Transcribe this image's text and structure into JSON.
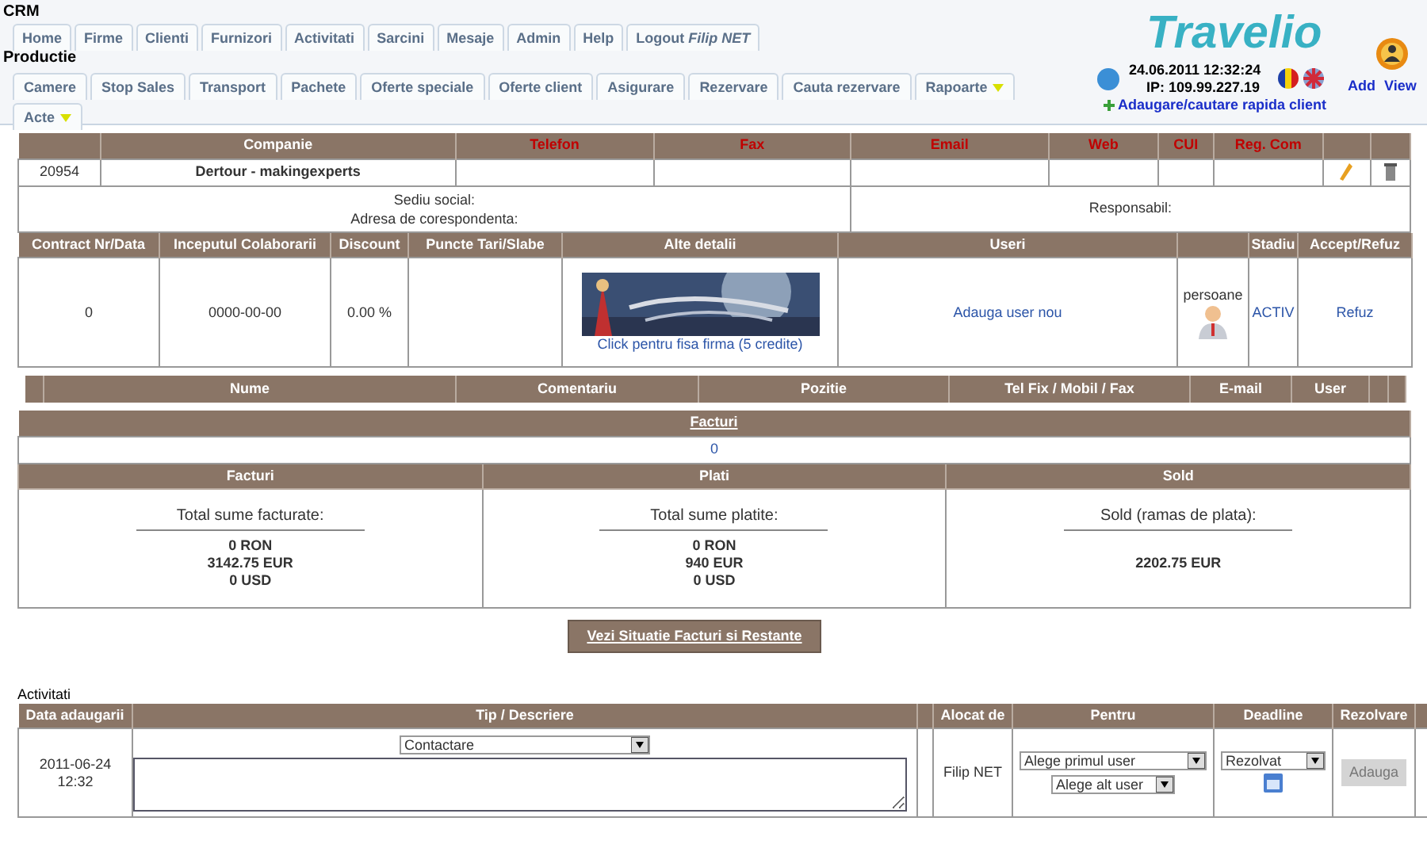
{
  "app_title": "CRM",
  "main_tabs": [
    {
      "label": "Home"
    },
    {
      "label": "Firme"
    },
    {
      "label": "Clienti"
    },
    {
      "label": "Furnizori"
    },
    {
      "label": "Activitati"
    },
    {
      "label": "Sarcini"
    },
    {
      "label": "Mesaje"
    },
    {
      "label": "Admin"
    },
    {
      "label": "Help"
    },
    {
      "label": "Logout *Filip NET*"
    }
  ],
  "section_title": "Productie",
  "sub_tabs": [
    {
      "label": "Camere",
      "dropdown": false
    },
    {
      "label": "Stop Sales",
      "dropdown": false
    },
    {
      "label": "Transport",
      "dropdown": false
    },
    {
      "label": "Pachete",
      "dropdown": false
    },
    {
      "label": "Oferte speciale",
      "dropdown": false
    },
    {
      "label": "Oferte client",
      "dropdown": false
    },
    {
      "label": "Asigurare",
      "dropdown": false
    },
    {
      "label": "Rezervare",
      "dropdown": false
    },
    {
      "label": "Cauta rezervare",
      "dropdown": false
    },
    {
      "label": "Rapoarte",
      "dropdown": true
    },
    {
      "label": "Acte",
      "dropdown": true
    }
  ],
  "header": {
    "logo": "Travelio",
    "datetime": "24.06.2011 12:32:24",
    "ip": "IP: 109.99.227.19",
    "quick_add": "Adaugare/cautare rapida client",
    "add": "Add",
    "view": "View"
  },
  "company_table": {
    "columns": [
      {
        "label": "Companie",
        "accent": false
      },
      {
        "label": "Telefon",
        "accent": true
      },
      {
        "label": "Fax",
        "accent": true
      },
      {
        "label": "Email",
        "accent": true
      },
      {
        "label": "Web",
        "accent": true
      },
      {
        "label": "CUI",
        "accent": true
      },
      {
        "label": "Reg. Com",
        "accent": true
      }
    ],
    "row": {
      "id": "20954",
      "name": "Dertour - makingexperts"
    },
    "address_labels": [
      "Sediu social:",
      "Adresa de corespondenta:"
    ],
    "responsible_label": "Responsabil:"
  },
  "contract_table": {
    "columns": [
      "Contract Nr/Data",
      "Inceputul Colaborarii",
      "Discount",
      "Puncte Tari/Slabe",
      "Alte detalii",
      "Useri",
      "Stadiu",
      "Accept/Refuz"
    ],
    "row": {
      "contract": "0",
      "start": "0000-00-00",
      "discount": "0.00 %",
      "details_link": "Click pentru fisa firma (5 credite)",
      "users_link": "Adauga user nou",
      "persons": "persoane",
      "status": "ACTIV",
      "action": "Refuz"
    }
  },
  "persons_table": {
    "columns": [
      "Nume",
      "Comentariu",
      "Pozitie",
      "Tel Fix / Mobil / Fax",
      "E-mail",
      "User"
    ]
  },
  "invoices": {
    "title": "Facturi",
    "count": "0",
    "summary": [
      {
        "header": "Facturi",
        "label": "Total sume facturate:",
        "lines": [
          "0 RON",
          "3142.75 EUR",
          "0 USD"
        ]
      },
      {
        "header": "Plati",
        "label": "Total sume platite:",
        "lines": [
          "0 RON",
          "940 EUR",
          "0 USD"
        ]
      },
      {
        "header": "Sold",
        "label": "Sold (ramas de plata):",
        "lines": [
          "2202.75 EUR"
        ]
      }
    ],
    "button": "Vezi Situatie Facturi si Restante"
  },
  "activities": {
    "title": "Activitati",
    "columns": [
      "Data adaugarii",
      "Tip / Descriere",
      "Alocat de",
      "Pentru",
      "Deadline",
      "Rezolvare"
    ],
    "row": {
      "date": "2011-06-24",
      "time": "12:32",
      "type": "Contactare",
      "assigned": "Filip NET",
      "first_user": "Alege primul user",
      "other_user": "Alege alt user",
      "deadline": "Rezolvat",
      "button": "Adauga",
      "button_disabled": true
    }
  }
}
